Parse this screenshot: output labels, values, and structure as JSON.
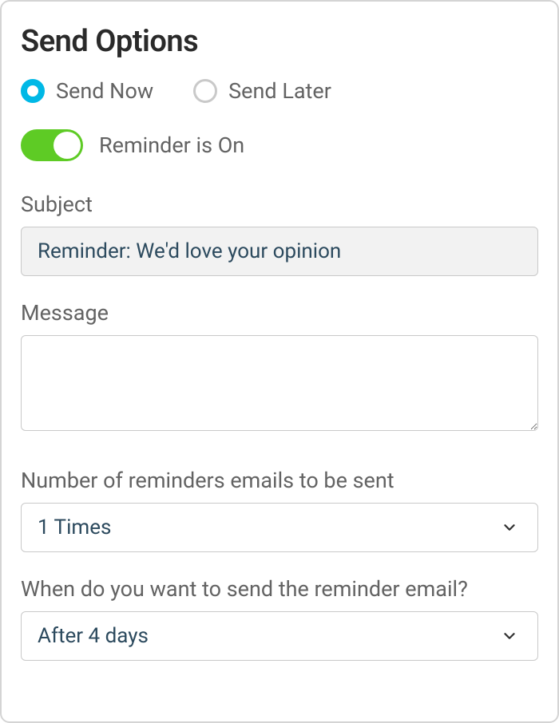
{
  "title": "Send Options",
  "sendTiming": {
    "now": "Send Now",
    "later": "Send Later",
    "selected": "now"
  },
  "reminderToggle": {
    "label": "Reminder is On",
    "on": true
  },
  "subject": {
    "label": "Subject",
    "value": "Reminder: We'd love your opinion"
  },
  "message": {
    "label": "Message",
    "value": ""
  },
  "reminderCount": {
    "label": "Number of reminders emails to be sent",
    "value": "1 Times"
  },
  "reminderWhen": {
    "label": "When do you want to send the reminder email?",
    "value": "After 4 days"
  }
}
